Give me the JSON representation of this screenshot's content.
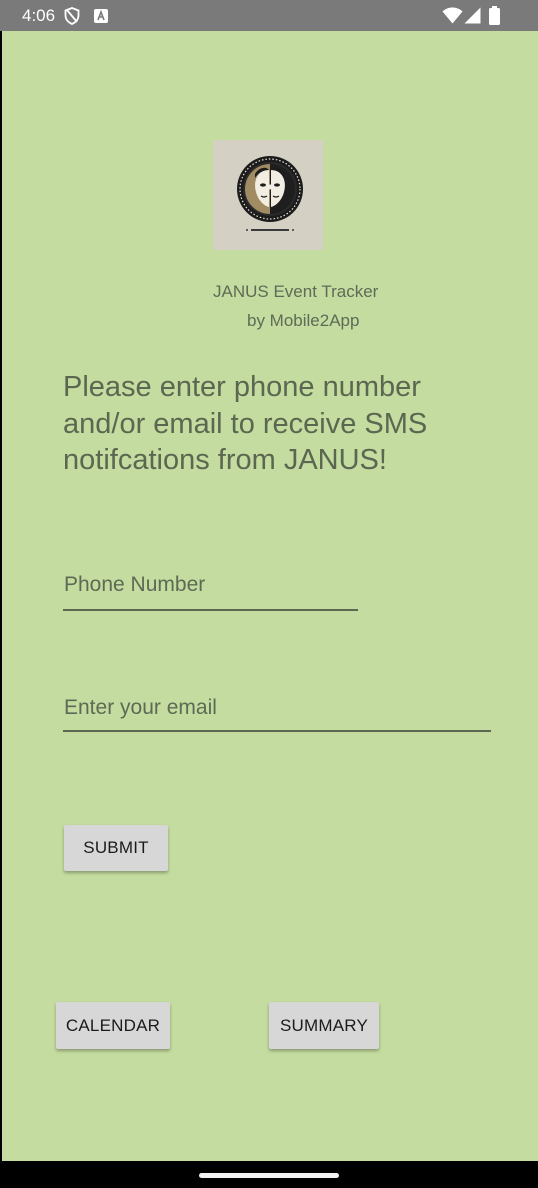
{
  "status_bar": {
    "time": "4:06",
    "icons": [
      "shield-icon",
      "font-a-icon",
      "wifi-icon",
      "cellular-signal-icon",
      "battery-icon"
    ]
  },
  "app": {
    "title": "JANUS Event Tracker",
    "subtitle": "by Mobile2App",
    "logo_icon": "janus-two-faces-icon",
    "prompt": "Please enter phone number and/or email to receive SMS notifcations from JANUS!"
  },
  "form": {
    "phone_placeholder": "Phone Number",
    "email_placeholder": "Enter your email",
    "submit_label": "SUBMIT"
  },
  "nav_buttons": {
    "calendar_label": "CALENDAR",
    "summary_label": "SUMMARY"
  },
  "colors": {
    "background": "#c4dc9f",
    "text": "#5b6751",
    "button": "#d6d7d6",
    "status_bar": "#7a7a7a"
  }
}
